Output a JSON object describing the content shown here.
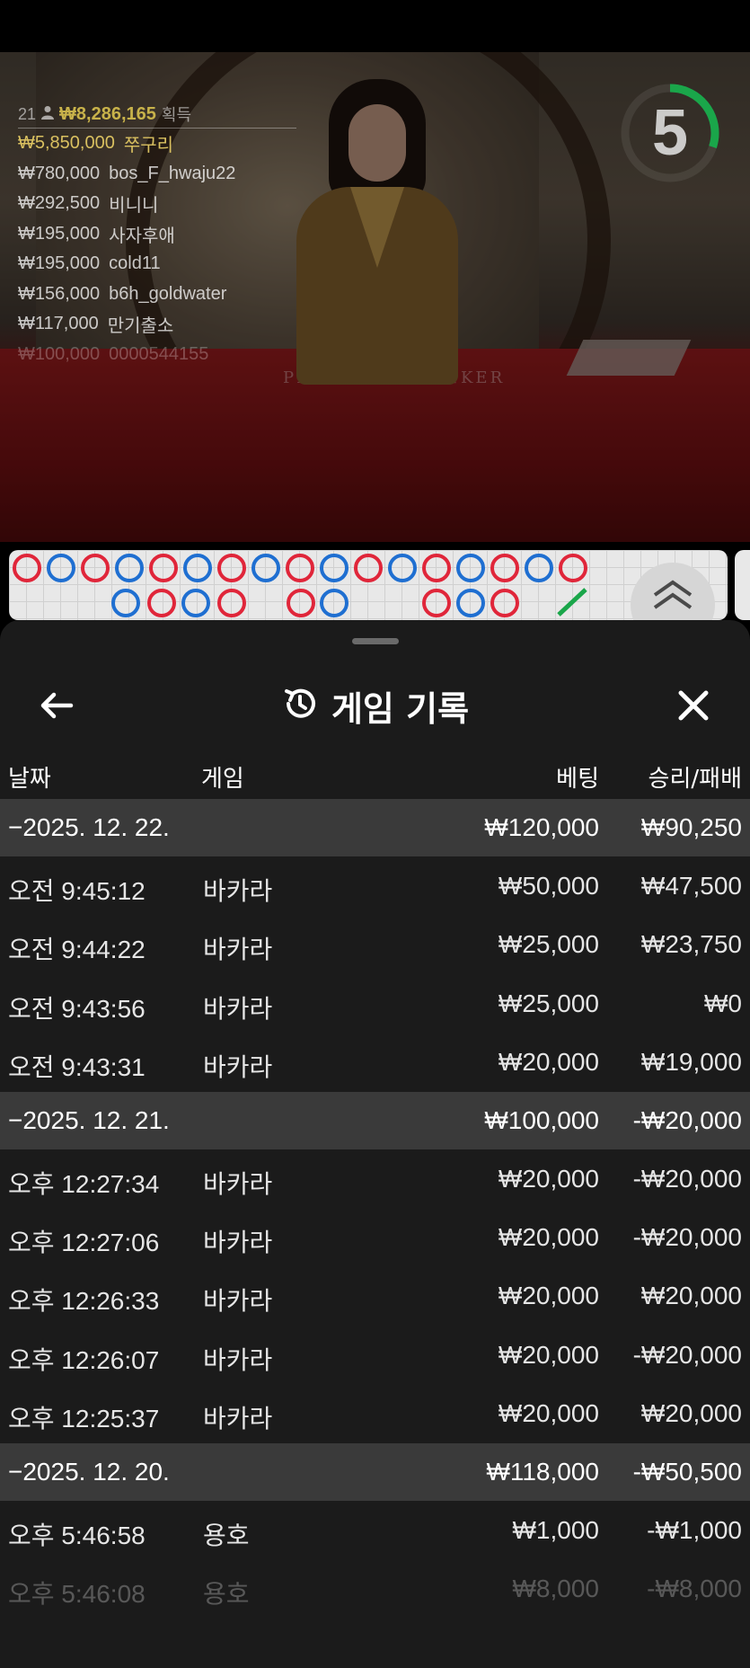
{
  "video": {
    "countdown": "5",
    "countdown_fraction": 0.3,
    "countdown_color": "#1aa64a",
    "table_labels": [
      "PLAYER",
      "BANKER"
    ],
    "winners": {
      "count": "21",
      "user_icon": "user-icon",
      "total": "₩8,286,165",
      "total_label": "획득",
      "entries": [
        {
          "amount": "₩5,850,000",
          "name": "쭈구리"
        },
        {
          "amount": "₩780,000",
          "name": "bos_F_hwaju22"
        },
        {
          "amount": "₩292,500",
          "name": "비니니"
        },
        {
          "amount": "₩195,000",
          "name": "사자후애"
        },
        {
          "amount": "₩195,000",
          "name": "cold11"
        },
        {
          "amount": "₩156,000",
          "name": "b6h_goldwater"
        },
        {
          "amount": "₩117,000",
          "name": "만기출소"
        },
        {
          "amount": "₩100,000",
          "name": "0000544155"
        }
      ]
    }
  },
  "roadmap": {
    "colors": {
      "banker": "#e0263a",
      "player": "#1f6fd1",
      "tie": "#1aa64a"
    },
    "expand_icon": "double-chevron-up-icon"
  },
  "sheet": {
    "title": "게임 기록",
    "back_icon": "arrow-left-icon",
    "history_icon": "history-icon",
    "close_icon": "close-icon",
    "columns": {
      "date": "날짜",
      "game": "게임",
      "bet": "베팅",
      "result": "승리/패배"
    },
    "groups": [
      {
        "date": "−2025. 12. 22.",
        "bet": "₩120,000",
        "result": "₩90,250",
        "rows": [
          {
            "time": "오전 9:45:12",
            "game": "바카라",
            "bet": "₩50,000",
            "result": "₩47,500"
          },
          {
            "time": "오전 9:44:22",
            "game": "바카라",
            "bet": "₩25,000",
            "result": "₩23,750"
          },
          {
            "time": "오전 9:43:56",
            "game": "바카라",
            "bet": "₩25,000",
            "result": "₩0"
          },
          {
            "time": "오전 9:43:31",
            "game": "바카라",
            "bet": "₩20,000",
            "result": "₩19,000"
          }
        ]
      },
      {
        "date": "−2025. 12. 21.",
        "bet": "₩100,000",
        "result": "-₩20,000",
        "rows": [
          {
            "time": "오후 12:27:34",
            "game": "바카라",
            "bet": "₩20,000",
            "result": "-₩20,000"
          },
          {
            "time": "오후 12:27:06",
            "game": "바카라",
            "bet": "₩20,000",
            "result": "-₩20,000"
          },
          {
            "time": "오후 12:26:33",
            "game": "바카라",
            "bet": "₩20,000",
            "result": "₩20,000"
          },
          {
            "time": "오후 12:26:07",
            "game": "바카라",
            "bet": "₩20,000",
            "result": "-₩20,000"
          },
          {
            "time": "오후 12:25:37",
            "game": "바카라",
            "bet": "₩20,000",
            "result": "₩20,000"
          }
        ]
      },
      {
        "date": "−2025. 12. 20.",
        "bet": "₩118,000",
        "result": "-₩50,500",
        "rows": [
          {
            "time": "오후 5:46:58",
            "game": "용호",
            "bet": "₩1,000",
            "result": "-₩1,000"
          },
          {
            "time": "오후 5:46:08",
            "game": "용호",
            "bet": "₩8,000",
            "result": "-₩8,000"
          }
        ]
      }
    ]
  }
}
